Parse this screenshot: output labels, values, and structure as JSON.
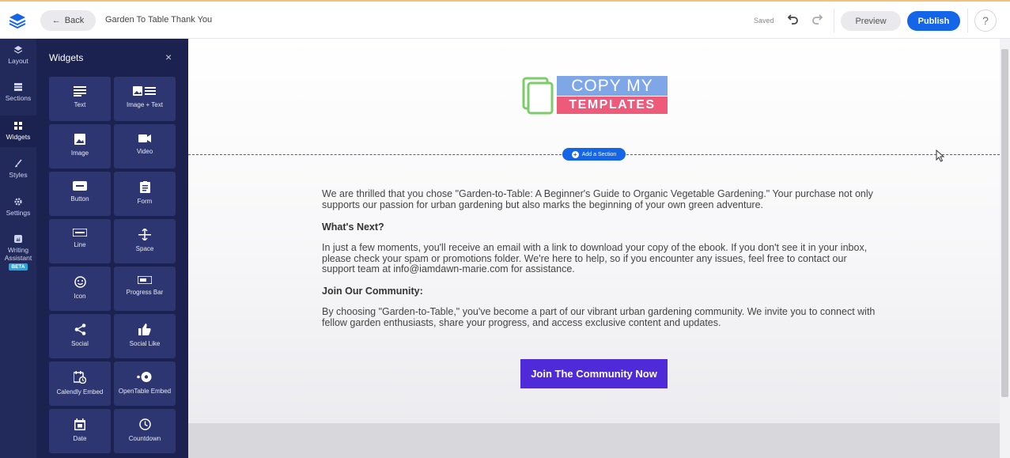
{
  "topbar": {
    "back_label": "Back",
    "page_title": "Garden To Table Thank You",
    "status": "Saved",
    "preview_label": "Preview",
    "publish_label": "Publish",
    "help_label": "?"
  },
  "rail": {
    "items": [
      {
        "label": "Layout",
        "icon": "layers-icon"
      },
      {
        "label": "Sections",
        "icon": "sections-icon"
      },
      {
        "label": "Widgets",
        "icon": "widgets-icon"
      },
      {
        "label": "Styles",
        "icon": "brush-icon"
      },
      {
        "label": "Settings",
        "icon": "gear-icon"
      },
      {
        "label": "Writing Assistant",
        "icon": "ai-icon"
      }
    ],
    "badge": "BETA",
    "active": "Widgets"
  },
  "panel": {
    "title": "Widgets",
    "close": "×",
    "widgets": [
      {
        "label": "Text",
        "icon": "text-icon"
      },
      {
        "label": "Image + Text",
        "icon": "image-text-icon"
      },
      {
        "label": "Image",
        "icon": "image-icon"
      },
      {
        "label": "Video",
        "icon": "video-icon"
      },
      {
        "label": "Button",
        "icon": "button-icon"
      },
      {
        "label": "Form",
        "icon": "form-icon"
      },
      {
        "label": "Line",
        "icon": "line-icon"
      },
      {
        "label": "Space",
        "icon": "space-icon"
      },
      {
        "label": "Icon",
        "icon": "smiley-icon"
      },
      {
        "label": "Progress Bar",
        "icon": "progress-bar-icon"
      },
      {
        "label": "Social",
        "icon": "share-icon"
      },
      {
        "label": "Social Like",
        "icon": "thumbs-up-icon"
      },
      {
        "label": "Calendly Embed",
        "icon": "calendar-clock-icon"
      },
      {
        "label": "OpenTable Embed",
        "icon": "opentable-icon"
      },
      {
        "label": "Date",
        "icon": "date-icon"
      },
      {
        "label": "Countdown",
        "icon": "clock-icon"
      }
    ]
  },
  "canvas": {
    "brand_top": "COPY MY",
    "brand_bottom": "TEMPLATES",
    "add_section_label": "Add a Section",
    "intro": "We are thrilled that you chose \"Garden-to-Table: A Beginner's Guide to Organic Vegetable Gardening.\" Your purchase not only supports our passion for urban gardening but also marks the beginning of your own green adventure.",
    "heading_next": "What's Next?",
    "next_text": "In just a few moments, you'll receive an email with a link to download your copy of the ebook. If you don't see it in your inbox, please check your spam or promotions folder. We're here to help, so if you encounter any issues, feel free to contact our support team at info@iamdawn-marie.com for assistance.",
    "heading_community": "Join Our Community:",
    "community_text": "By choosing \"Garden-to-Table,\" you've become a part of our vibrant urban gardening community. We invite you to connect with fellow garden enthusiasts, share your progress, and access exclusive content and updates.",
    "cta_label": "Join The Community Now"
  },
  "colors": {
    "accent": "#1565e8",
    "rail_bg": "#222a5c",
    "panel_bg": "#1b2250",
    "tile_bg": "#2d3670",
    "cta": "#4f2ad8",
    "brand_blue": "#7fa7e8",
    "brand_pink": "#ee5a7a",
    "brand_green": "#7ccc6a"
  }
}
